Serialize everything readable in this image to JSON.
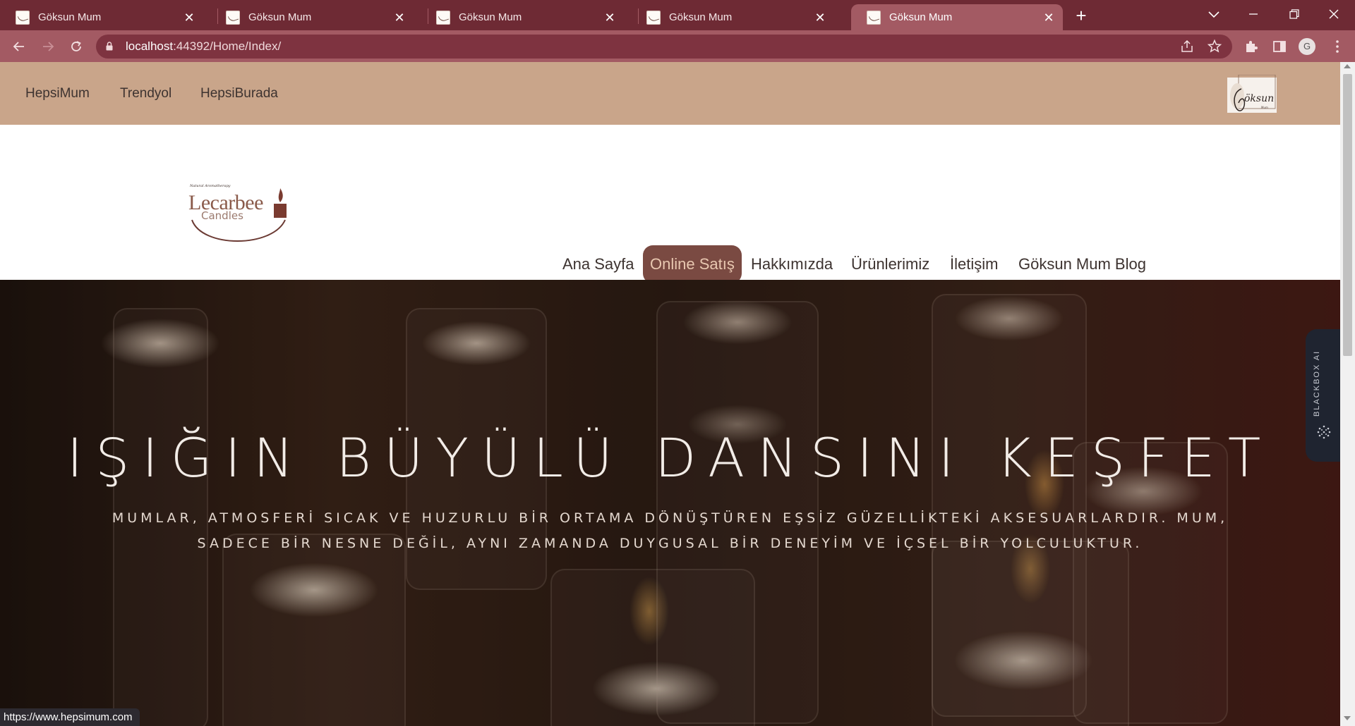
{
  "browser": {
    "tabs": [
      {
        "title": "Göksun Mum",
        "active": false
      },
      {
        "title": "Göksun Mum",
        "active": false
      },
      {
        "title": "Göksun Mum",
        "active": false
      },
      {
        "title": "Göksun Mum",
        "active": false
      },
      {
        "title": "Göksun Mum",
        "active": true
      }
    ],
    "url_host": "localhost",
    "url_rest": ":44392/Home/Index/",
    "profile_initial": "G",
    "status_link": "https://www.hepsimum.com"
  },
  "topbar": {
    "links": [
      "HepsiMum",
      "Trendyol",
      "HepsiBurada"
    ],
    "logo_text": "Göksun"
  },
  "brand": {
    "tagline": "Natural Aromatherapy",
    "name": "Lecarbee",
    "sub": "Candles"
  },
  "nav": {
    "items": [
      "Ana Sayfa",
      "Online Satış",
      "Hakkımızda",
      "Ürünlerimiz",
      "İletişim",
      "Göksun Mum Blog"
    ],
    "active_index": 1
  },
  "hero": {
    "title": "IŞIĞIN BÜYÜLÜ DANSINI KEŞFET",
    "text": "MUMLAR, ATMOSFERİ SICAK VE HUZURLU BİR ORTAMA DÖNÜŞTÜREN EŞSİZ GÜZELLİKTEKİ AKSESUARLARDIR. MUM, SADECE BİR NESNE DEĞİL, AYNI ZAMANDA DUYGUSAL BİR DENEYİM VE İÇSEL BİR YOLCULUKTUR."
  },
  "extension_panel": {
    "label": "BLACKBOX AI"
  },
  "colors": {
    "tabbar": "#6e2a34",
    "toolbar": "#a35a63",
    "topbar": "#c9a58a",
    "nav_active_bg": "#7a4a42",
    "nav_active_text": "#e8c7b0"
  }
}
